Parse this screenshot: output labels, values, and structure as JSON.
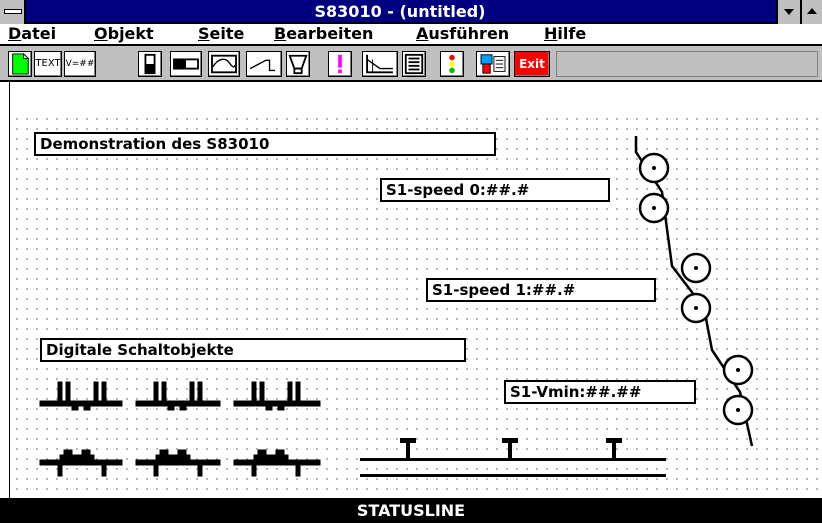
{
  "window": {
    "title": "S83010 - (untitled)"
  },
  "menu": {
    "items": [
      {
        "label": "Datei"
      },
      {
        "label": "Objekt"
      },
      {
        "label": "Seite"
      },
      {
        "label": "Bearbeiten"
      },
      {
        "label": "Ausführen"
      },
      {
        "label": "Hilfe"
      }
    ]
  },
  "toolbar": {
    "buttons": [
      {
        "name": "new-document-tool",
        "icon": "new-page-icon"
      },
      {
        "name": "text-tool",
        "label": "TEXT",
        "icon": "text-icon"
      },
      {
        "name": "variable-tool",
        "label": "V=##",
        "icon": "variable-icon"
      },
      {
        "name": "vertical-bar-tool",
        "icon": "vertical-bar-icon"
      },
      {
        "name": "horizontal-bar-tool",
        "icon": "horizontal-bar-icon"
      },
      {
        "name": "curve-tool",
        "icon": "curve-icon"
      },
      {
        "name": "line-tool",
        "icon": "line-icon"
      },
      {
        "name": "funnel-tool",
        "icon": "funnel-icon"
      },
      {
        "name": "alarm-tool",
        "icon": "exclamation-icon"
      },
      {
        "name": "trend-tool",
        "icon": "trend-icon"
      },
      {
        "name": "list-tool",
        "icon": "list-icon"
      },
      {
        "name": "traffic-light-tool",
        "icon": "traffic-light-icon"
      },
      {
        "name": "settings-tool",
        "icon": "settings-icon"
      },
      {
        "name": "exit-tool",
        "label": "Exit",
        "icon": "exit-icon"
      }
    ]
  },
  "canvas": {
    "labels": [
      {
        "name": "demo-title-label",
        "text": "Demonstration des S83010"
      },
      {
        "name": "speed-0-field",
        "text": "S1-speed 0:##.#"
      },
      {
        "name": "speed-1-field",
        "text": "S1-speed 1:##.#"
      },
      {
        "name": "digital-objects-label",
        "text": "Digitale Schaltobjekte"
      },
      {
        "name": "vmin-field",
        "text": "S1-Vmin:##.##"
      }
    ]
  },
  "status": {
    "text": "STATUSLINE"
  },
  "colors": {
    "titlebar": "#000080",
    "toolbar": "#c0c0c0",
    "status": "#000000",
    "exit": "#ff0000",
    "alarm": "#ff00ff",
    "new_doc": "#00ff00"
  }
}
